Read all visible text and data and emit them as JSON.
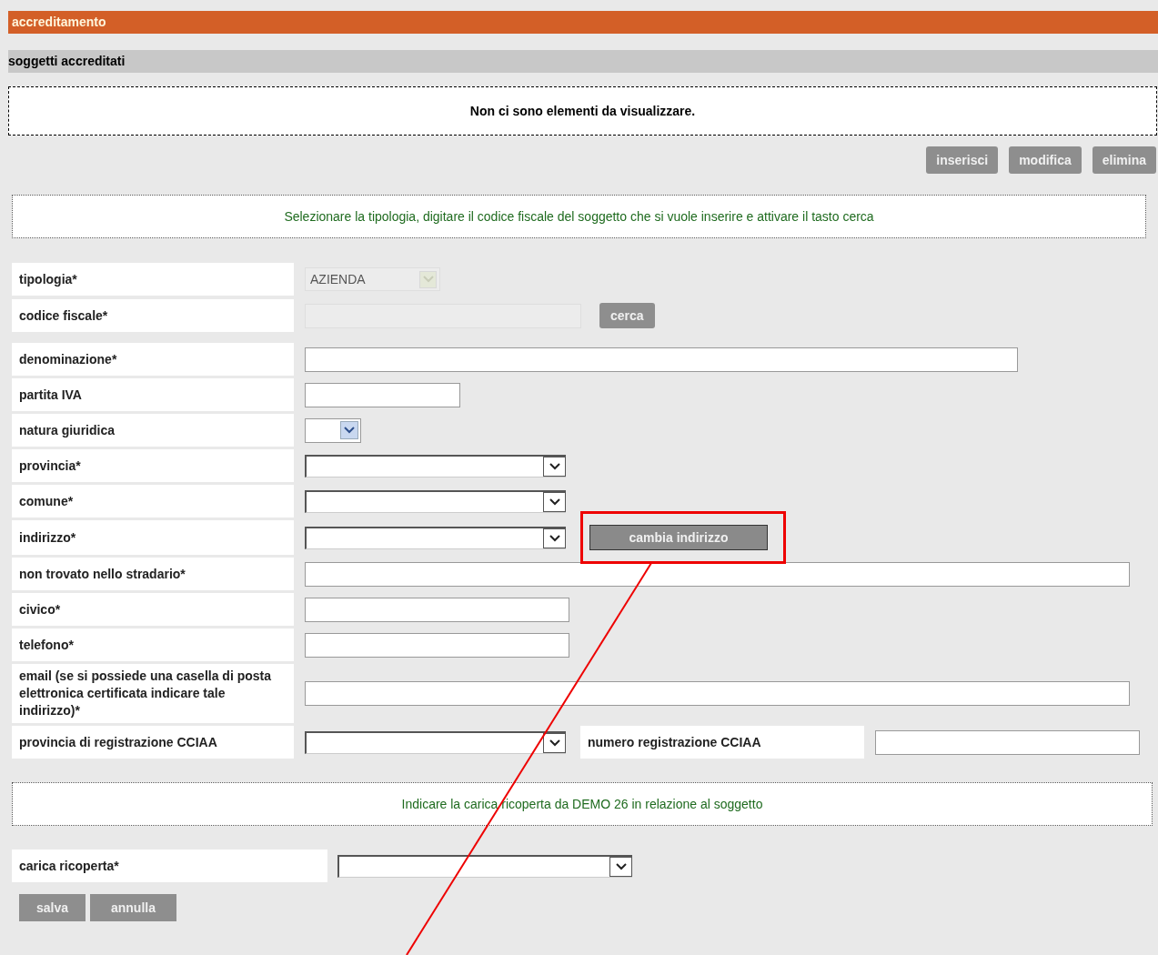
{
  "header": {
    "title": "accreditamento"
  },
  "section": {
    "title": "soggetti accreditati"
  },
  "empty_message": "Non ci sono elementi da visualizzare.",
  "list_buttons": [
    "inserisci",
    "modifica",
    "elimina"
  ],
  "instruction": "Selezionare la tipologia, digitare il codice fiscale del soggetto che si vuole inserire e attivare il tasto cerca",
  "search_fields": [
    {
      "label": "tipologia*",
      "kind": "select",
      "value": "AZIENDA",
      "disabled": true
    },
    {
      "label": "codice fiscale*",
      "kind": "text",
      "disabled": true,
      "button": "cerca"
    }
  ],
  "fields": [
    {
      "label": "denominazione*",
      "kind": "text"
    },
    {
      "label": "partita IVA",
      "kind": "text"
    },
    {
      "label": "natura giuridica",
      "kind": "mini-select"
    },
    {
      "label": "provincia*",
      "kind": "select"
    },
    {
      "label": "comune*",
      "kind": "select"
    },
    {
      "label": "indirizzo*",
      "kind": "select",
      "button": "cambia indirizzo"
    },
    {
      "label": "non trovato nello stradario*",
      "kind": "text"
    },
    {
      "label": "civico*",
      "kind": "text"
    },
    {
      "label": "telefono*",
      "kind": "text"
    },
    {
      "label": "email (se si possiede una casella di posta elettronica certificata indicare tale indirizzo)*",
      "kind": "text"
    },
    {
      "label": "provincia di registrazione CCIAA",
      "kind": "select",
      "extra_label": "numero registrazione CCIAA"
    }
  ],
  "role_instruction": "Indicare la carica ricoperta da DEMO 26 in relazione al soggetto",
  "role_field": {
    "label": "carica ricoperta*",
    "kind": "select"
  },
  "form_buttons": [
    "salva",
    "annulla"
  ]
}
